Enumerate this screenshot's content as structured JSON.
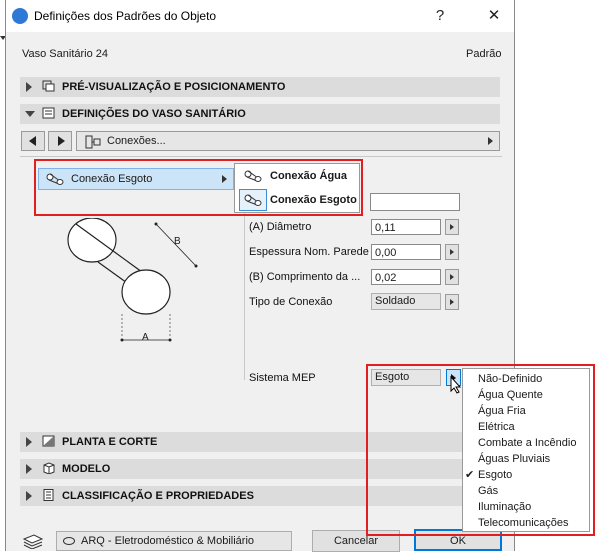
{
  "window": {
    "title": "Definições dos Padrões do Objeto",
    "help": "?",
    "close": "✕"
  },
  "header": {
    "object_name": "Vaso Sanitário 24",
    "status": "Padrão"
  },
  "sections": {
    "preview": "PRÉ-VISUALIZAÇÃO E POSICIONAMENTO",
    "settings": "DEFINIÇÕES DO VASO SANITÁRIO",
    "plan": "PLANTA E CORTE",
    "model": "MODELO",
    "classification": "CLASSIFICAÇÃO E PROPRIEDADES"
  },
  "nav": {
    "page_selector": "Conexões..."
  },
  "connection_menu": {
    "selected": "Conexão Esgoto",
    "items": [
      "Conexão Água",
      "Conexão Esgoto"
    ]
  },
  "diagram": {
    "label_a": "A",
    "label_b": "B"
  },
  "fields": {
    "top_value": "",
    "diameter_label": "(A) Diâmetro",
    "diameter_value": "0,11",
    "thickness_label": "Espessura Nom. Parede",
    "thickness_value": "0,00",
    "length_label": "(B) Comprimento da ...",
    "length_value": "0,02",
    "type_label": "Tipo de Conexão",
    "type_value": "Soldado",
    "mep_label": "Sistema MEP",
    "mep_value": "Esgoto"
  },
  "mep_menu": {
    "items": [
      "Não-Definido",
      "Água Quente",
      "Água Fria",
      "Elétrica",
      "Combate a Incêndio",
      "Águas Pluviais",
      "Esgoto",
      "Gás",
      "Iluminação",
      "Telecomunicações"
    ],
    "checked": "✔"
  },
  "footer": {
    "layer": "ARQ - Eletrodoméstico & Mobiliário",
    "cancel": "Cancelar",
    "ok": "OK"
  },
  "colors": {
    "highlight": "#e02020",
    "selection": "#cce4f7",
    "accent": "#0078d7"
  }
}
